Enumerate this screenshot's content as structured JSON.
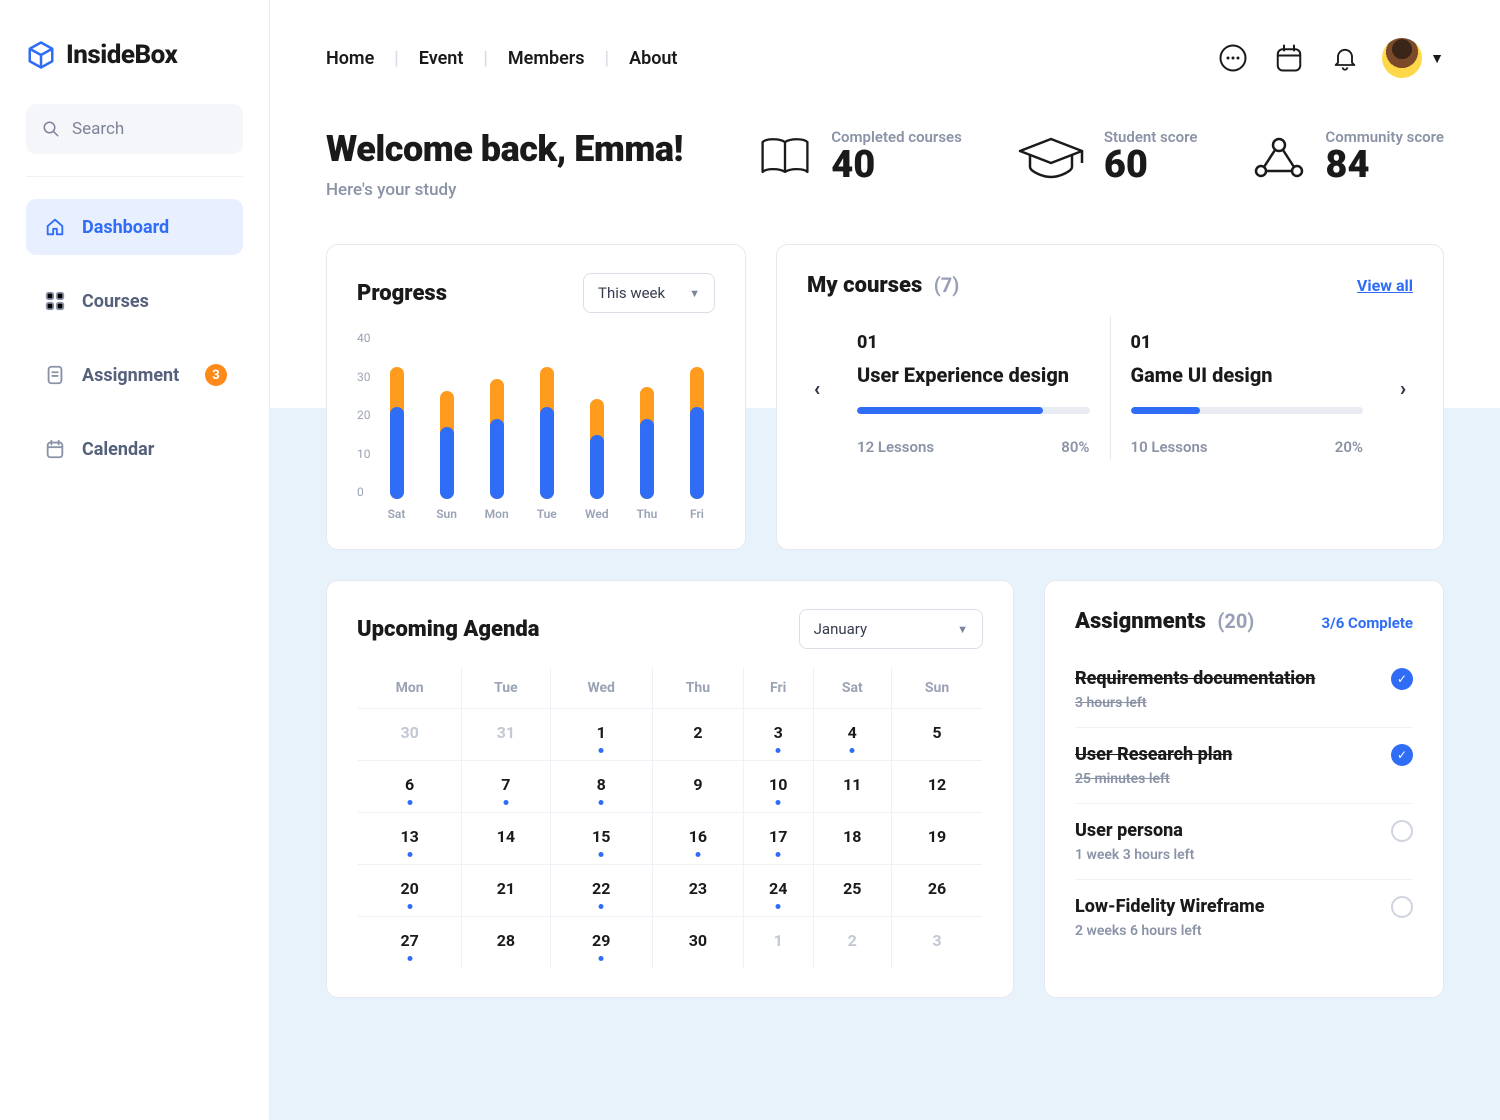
{
  "brand": "InsideBox",
  "search_placeholder": "Search",
  "sidebar": {
    "items": [
      {
        "label": "Dashboard",
        "active": true
      },
      {
        "label": "Courses"
      },
      {
        "label": "Assignment",
        "badge": "3"
      },
      {
        "label": "Calendar"
      }
    ]
  },
  "topnav": [
    "Home",
    "Event",
    "Members",
    "About"
  ],
  "hero": {
    "title": "Welcome back, Emma!",
    "subtitle": "Here's your study"
  },
  "stats": [
    {
      "label": "Completed courses",
      "value": "40"
    },
    {
      "label": "Student score",
      "value": "60"
    },
    {
      "label": "Community score",
      "value": "84"
    }
  ],
  "progress": {
    "title": "Progress",
    "range_label": "This week"
  },
  "chart_data": {
    "type": "bar",
    "categories": [
      "Sat",
      "Sun",
      "Mon",
      "Tue",
      "Wed",
      "Thu",
      "Fri"
    ],
    "series": [
      {
        "name": "primary",
        "values": [
          23,
          18,
          20,
          23,
          16,
          20,
          23
        ],
        "color": "#2f6df6"
      },
      {
        "name": "secondary",
        "values": [
          10,
          9,
          10,
          10,
          9,
          8,
          10
        ],
        "color": "#ff9b1d"
      }
    ],
    "ylim": [
      0,
      40
    ],
    "yticks": [
      40,
      30,
      20,
      10,
      0
    ]
  },
  "courses": {
    "title": "My courses",
    "count": "(7)",
    "view_all": "View all",
    "items": [
      {
        "num": "01",
        "name": "User Experience design",
        "lessons": "12 Lessons",
        "pct_label": "80%",
        "pct": 80
      },
      {
        "num": "01",
        "name": "Game UI design",
        "lessons": "10 Lessons",
        "pct_label": "20%",
        "pct": 30
      }
    ]
  },
  "agenda": {
    "title": "Upcoming Agenda",
    "month": "January",
    "dow": [
      "Mon",
      "Tue",
      "Wed",
      "Thu",
      "Fri",
      "Sat",
      "Sun"
    ],
    "days": [
      [
        {
          "d": "30",
          "faded": true
        },
        {
          "d": "31",
          "faded": true
        },
        {
          "d": "1",
          "dot": true
        },
        {
          "d": "2"
        },
        {
          "d": "3",
          "dot": true
        },
        {
          "d": "4",
          "dot": true
        },
        {
          "d": "5"
        }
      ],
      [
        {
          "d": "6",
          "dot": true
        },
        {
          "d": "7",
          "dot": true
        },
        {
          "d": "8",
          "dot": true
        },
        {
          "d": "9"
        },
        {
          "d": "10",
          "dot": true
        },
        {
          "d": "11"
        },
        {
          "d": "12"
        }
      ],
      [
        {
          "d": "13",
          "dot": true
        },
        {
          "d": "14"
        },
        {
          "d": "15",
          "dot": true
        },
        {
          "d": "16",
          "dot": true
        },
        {
          "d": "17",
          "dot": true
        },
        {
          "d": "18"
        },
        {
          "d": "19"
        }
      ],
      [
        {
          "d": "20",
          "dot": true
        },
        {
          "d": "21"
        },
        {
          "d": "22",
          "dot": true
        },
        {
          "d": "23"
        },
        {
          "d": "24",
          "dot": true
        },
        {
          "d": "25"
        },
        {
          "d": "26"
        }
      ],
      [
        {
          "d": "27",
          "dot": true
        },
        {
          "d": "28"
        },
        {
          "d": "29",
          "dot": true
        },
        {
          "d": "30"
        },
        {
          "d": "1",
          "faded": true
        },
        {
          "d": "2",
          "faded": true
        },
        {
          "d": "3",
          "faded": true
        }
      ]
    ]
  },
  "assignments": {
    "title": "Assignments",
    "count": "(20)",
    "complete": "3/6 Complete",
    "items": [
      {
        "title": "Requirements documentation",
        "time": "3 hours left",
        "done": true
      },
      {
        "title": "User Research plan",
        "time": "25 minutes left",
        "done": true
      },
      {
        "title": "User persona",
        "time": "1 week 3 hours left",
        "done": false
      },
      {
        "title": "Low-Fidelity Wireframe",
        "time": "2 weeks 6 hours left",
        "done": false
      }
    ]
  }
}
